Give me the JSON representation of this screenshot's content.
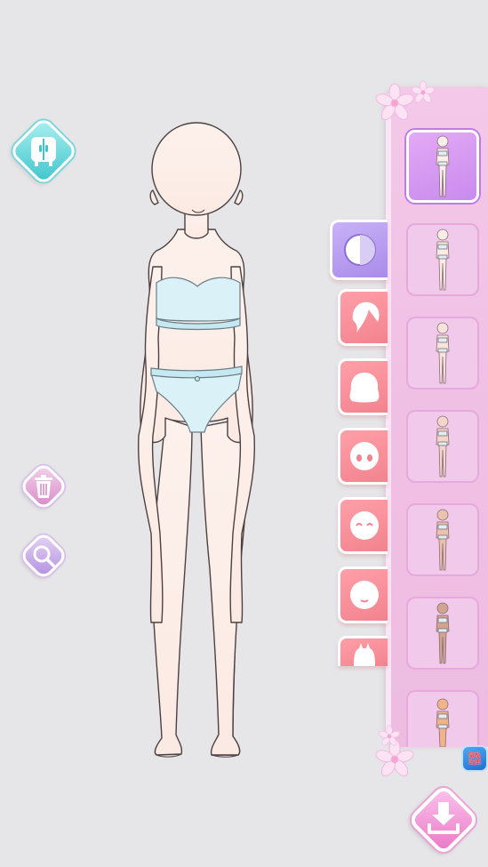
{
  "screen": {
    "background": "#e6e6e8",
    "skin_color": "#fdf0ea",
    "outline_color": "#5a4b4b",
    "underwear_color": "#d8f0f6"
  },
  "left_buttons": [
    {
      "id": "wardrobe",
      "icon": "wardrobe-icon",
      "color": "#3fc5cc"
    },
    {
      "id": "trash",
      "icon": "trash-icon",
      "color": "#d88ac9"
    },
    {
      "id": "zoom",
      "icon": "magnifier-icon",
      "color": "#b490e0"
    }
  ],
  "category_tabs": [
    {
      "icon": "body-base-icon",
      "active": true
    },
    {
      "icon": "bangs-hair-icon",
      "active": false
    },
    {
      "icon": "back-hair-icon",
      "active": false
    },
    {
      "icon": "eyes-face-icon",
      "active": false
    },
    {
      "icon": "smiling-face-icon",
      "active": false
    },
    {
      "icon": "mouth-face-icon",
      "active": false
    },
    {
      "icon": "outfit-icon",
      "active": false
    }
  ],
  "body_options": [
    {
      "skin": "#fbefe9",
      "selected": true
    },
    {
      "skin": "#fbece6",
      "selected": false
    },
    {
      "skin": "#f8e4dc",
      "selected": false
    },
    {
      "skin": "#f3d6c8",
      "selected": false
    },
    {
      "skin": "#e9c2b0",
      "selected": false
    },
    {
      "skin": "#cfa58f",
      "selected": false
    },
    {
      "skin": "#f1b48a",
      "selected": false
    }
  ],
  "privacy_badge": {
    "line1": "隐私",
    "line2": "政策"
  },
  "download": {
    "icon": "download-icon",
    "color": "#ea78c8"
  }
}
